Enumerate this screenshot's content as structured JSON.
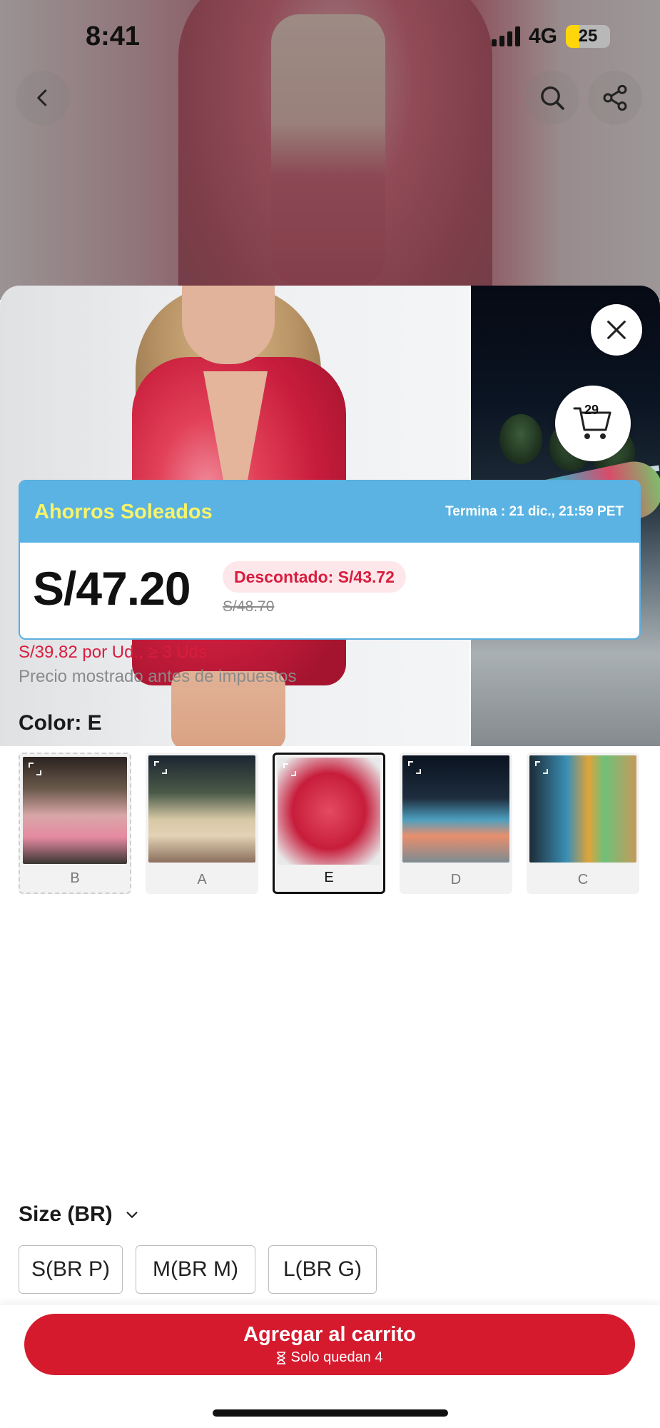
{
  "status_bar": {
    "time": "8:41",
    "network": "4G",
    "battery": "25"
  },
  "header": {
    "back_icon": "chevron-left-icon",
    "search_icon": "search-icon",
    "share_icon": "share-icon"
  },
  "gallery": {
    "close_icon": "close-icon",
    "cart_icon": "cart-icon",
    "cart_count": "29"
  },
  "promo": {
    "title": "Ahorros Soleados",
    "ends": "Termina : 21 dic., 21:59 PET",
    "price": "S/47.20",
    "discount": "Descontado: S/43.72",
    "original_price": "S/48.70",
    "title_color": "#f7f36a",
    "header_color": "#5ab3e2"
  },
  "bulk_price": "S/39.82 por Ud., ≥ 3 Uds",
  "tax_note": "Precio mostrado antes de impuestos",
  "color": {
    "heading": "Color: E",
    "options": [
      {
        "label": "B"
      },
      {
        "label": "A"
      },
      {
        "label": "E",
        "selected": true
      },
      {
        "label": "D"
      },
      {
        "label": "C"
      }
    ]
  },
  "size": {
    "heading": "Size (BR)",
    "options": [
      "S(BR P)",
      "M(BR M)",
      "L(BR G)"
    ]
  },
  "add_to_cart": {
    "label": "Agregar al carrito",
    "stock_note": "Solo quedan 4",
    "color": "#d61a2e"
  }
}
